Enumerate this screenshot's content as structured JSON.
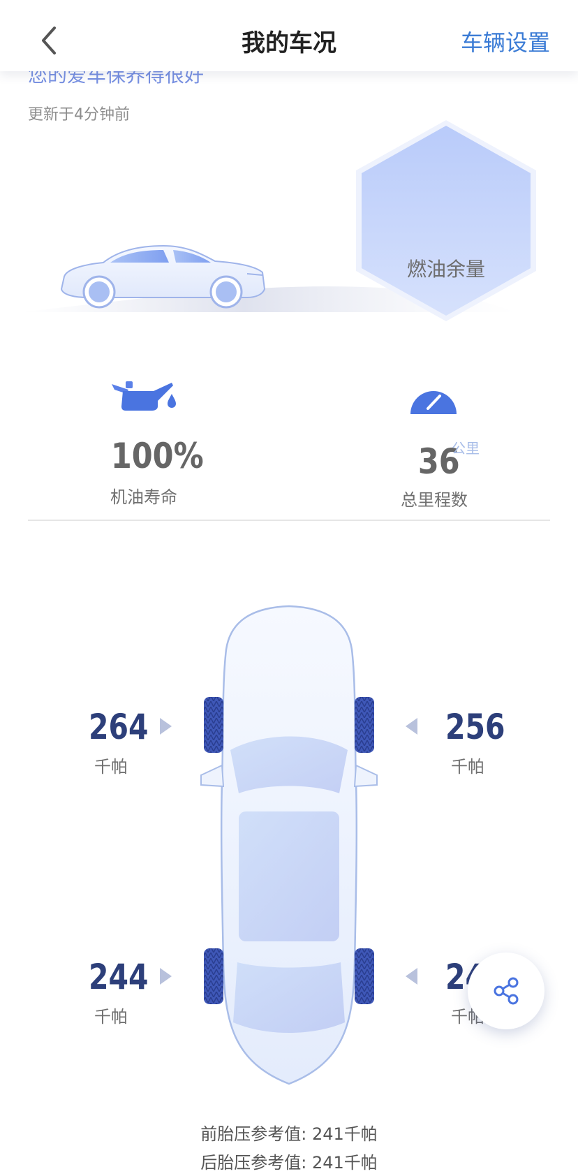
{
  "header": {
    "title": "我的车况",
    "settings_label": "车辆设置",
    "back_icon": "chevron-left-icon"
  },
  "status": {
    "partial_text": "您的爱车保养得很好",
    "update_time": "更新于4分钟前"
  },
  "fuel": {
    "label": "燃油余量"
  },
  "stats": {
    "oil": {
      "icon": "oil-can-icon",
      "value": "100%",
      "label": "机油寿命"
    },
    "mileage": {
      "icon": "speedometer-icon",
      "value": "36",
      "unit": "公里",
      "label": "总里程数"
    }
  },
  "tires": {
    "front_left": {
      "value": "264",
      "unit": "千帕"
    },
    "front_right": {
      "value": "256",
      "unit": "千帕"
    },
    "rear_left": {
      "value": "244",
      "unit": "千帕"
    },
    "rear_right": {
      "value": "24",
      "unit": "千帕"
    }
  },
  "reference": {
    "front": "前胎压参考值: 241千帕",
    "rear": "后胎压参考值: 241千帕"
  },
  "share": {
    "icon": "share-icon"
  },
  "colors": {
    "accent": "#3a7bd5",
    "tire_value": "#2d3f7a",
    "car_fill": "#dbe6fb"
  }
}
